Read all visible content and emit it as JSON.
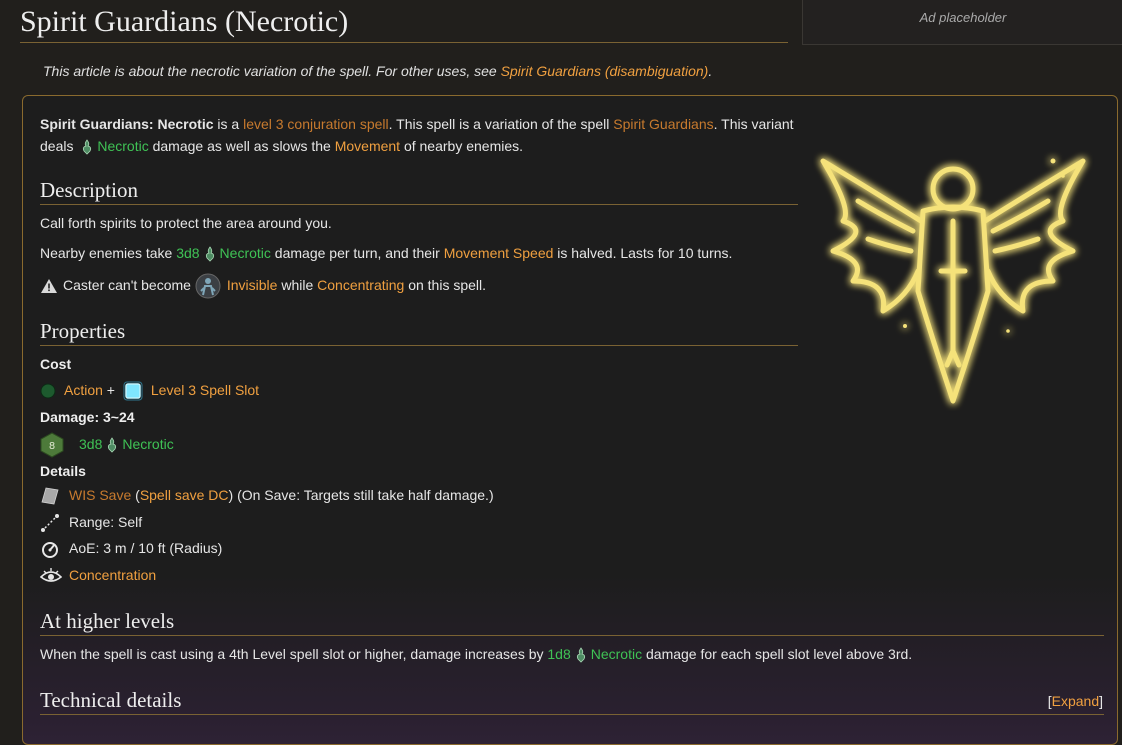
{
  "title": "Spirit Guardians (Necrotic)",
  "ad": "Ad placeholder",
  "hatnote": {
    "prefix": "This article is about the necrotic variation of the spell. For other uses, see ",
    "link": "Spirit Guardians (disambiguation)",
    "suffix": "."
  },
  "intro": {
    "name": "Spirit Guardians: ",
    "name_bold2": "Necrotic",
    "t1": " is a ",
    "level_link": "level 3 conjuration spell",
    "t2": ". This spell is a variation of the spell ",
    "spell_link": "Spirit Guardians",
    "t3": ". This variant",
    "t4": "deals ",
    "necrotic": "Necrotic",
    "t5": " damage as well as slows the ",
    "movement": "Movement",
    "t6": " of nearby enemies."
  },
  "description": {
    "heading": "Description",
    "line1": "Call forth spirits to protect the area around you.",
    "l2a": "Nearby enemies take ",
    "dice": "3d8",
    "necrotic": "Necrotic",
    "l2b": " damage per turn, and their ",
    "movement_speed": "Movement Speed",
    "l2c": " is halved. Lasts for 10 turns.",
    "w1": "Caster can't become ",
    "invisible": "Invisible",
    "w2": " while ",
    "concentrating": "Concentrating",
    "w3": " on this spell."
  },
  "properties": {
    "heading": "Properties",
    "cost_label": "Cost",
    "action": "Action",
    "plus": " + ",
    "spell_slot": "Level 3 Spell Slot",
    "damage_label": "Damage: 3~24",
    "damage_dice": "3d8",
    "damage_type": "Necrotic",
    "d8_face": "8",
    "details_label": "Details",
    "save": "WIS Save",
    "save_open": " (",
    "save_dc": "Spell save DC",
    "save_close": ") (On Save: Targets still take half damage.)",
    "range": "Range: Self",
    "aoe": "AoE: 3 m / 10 ft (Radius)",
    "concentration": "Concentration"
  },
  "higher": {
    "heading": "At higher levels",
    "t1": "When the spell is cast using a 4th Level spell slot or higher, damage increases by ",
    "dice": "1d8",
    "necrotic": "Necrotic",
    "t2": " damage for each spell slot level above 3rd."
  },
  "technical": {
    "heading": "Technical details",
    "expand_open": "[",
    "expand": "Expand",
    "expand_close": "]"
  },
  "colors": {
    "link": "#f0a040",
    "necrotic": "#3fc255",
    "border_gold": "#8a6a2e",
    "background": "#211f1c",
    "glow": "#f5e27a"
  }
}
